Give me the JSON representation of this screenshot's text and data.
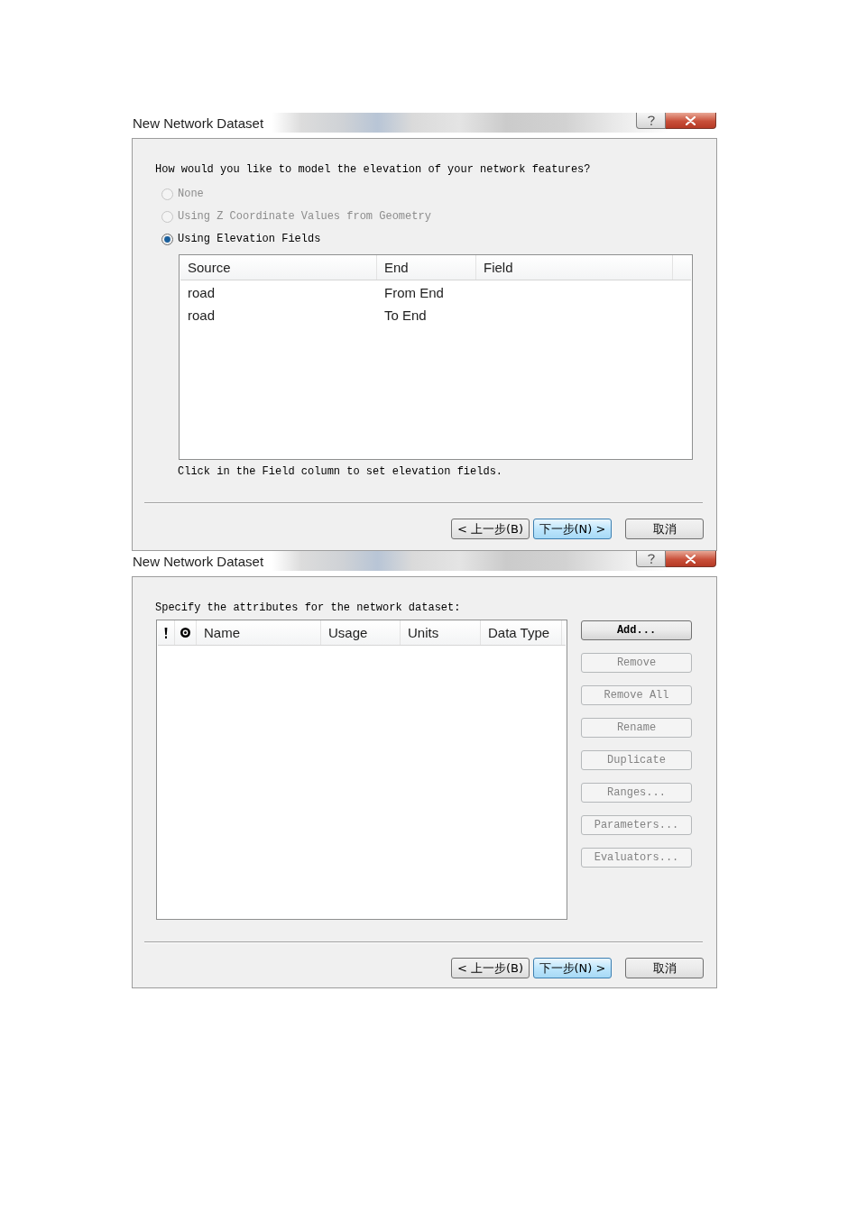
{
  "dialogs": [
    {
      "kind": "elevation",
      "title": "New Network Dataset",
      "prompt": "How would you like to model the elevation of your network features?",
      "options": [
        {
          "label": "None",
          "selected": false,
          "disabled": true
        },
        {
          "label": "Using Z Coordinate Values from Geometry",
          "selected": false,
          "disabled": true
        },
        {
          "label": "Using Elevation Fields",
          "selected": true,
          "disabled": false
        }
      ],
      "table": {
        "columns": [
          "Source",
          "End",
          "Field"
        ],
        "rows": [
          [
            "road",
            "From End"
          ],
          [
            "road",
            "To End"
          ]
        ]
      },
      "note": "Click in the Field column to set elevation fields.",
      "buttons": [
        {
          "label": "< 上一步(B)",
          "focused": false
        },
        {
          "label": "下一步(N) >",
          "focused": true
        },
        {
          "label": "取消",
          "focused": false
        }
      ]
    },
    {
      "kind": "attributes",
      "title": "New Network Dataset",
      "prompt": "Specify the attributes for the network dataset:",
      "table": {
        "columns": [
          "Name",
          "Usage",
          "Units",
          "Data Type"
        ]
      },
      "side_buttons": [
        {
          "label": "Add...",
          "disabled": false
        },
        {
          "label": "Remove",
          "disabled": true
        },
        {
          "label": "Remove All",
          "disabled": true
        },
        {
          "label": "Rename",
          "disabled": true
        },
        {
          "label": "Duplicate",
          "disabled": true
        },
        {
          "label": "Ranges...",
          "disabled": true
        },
        {
          "label": "Parameters...",
          "disabled": true
        },
        {
          "label": "Evaluators...",
          "disabled": true
        }
      ],
      "buttons": [
        {
          "label": "< 上一步(B)",
          "focused": false
        },
        {
          "label": "下一步(N) >",
          "focused": true
        },
        {
          "label": "取消",
          "focused": false
        }
      ]
    }
  ]
}
